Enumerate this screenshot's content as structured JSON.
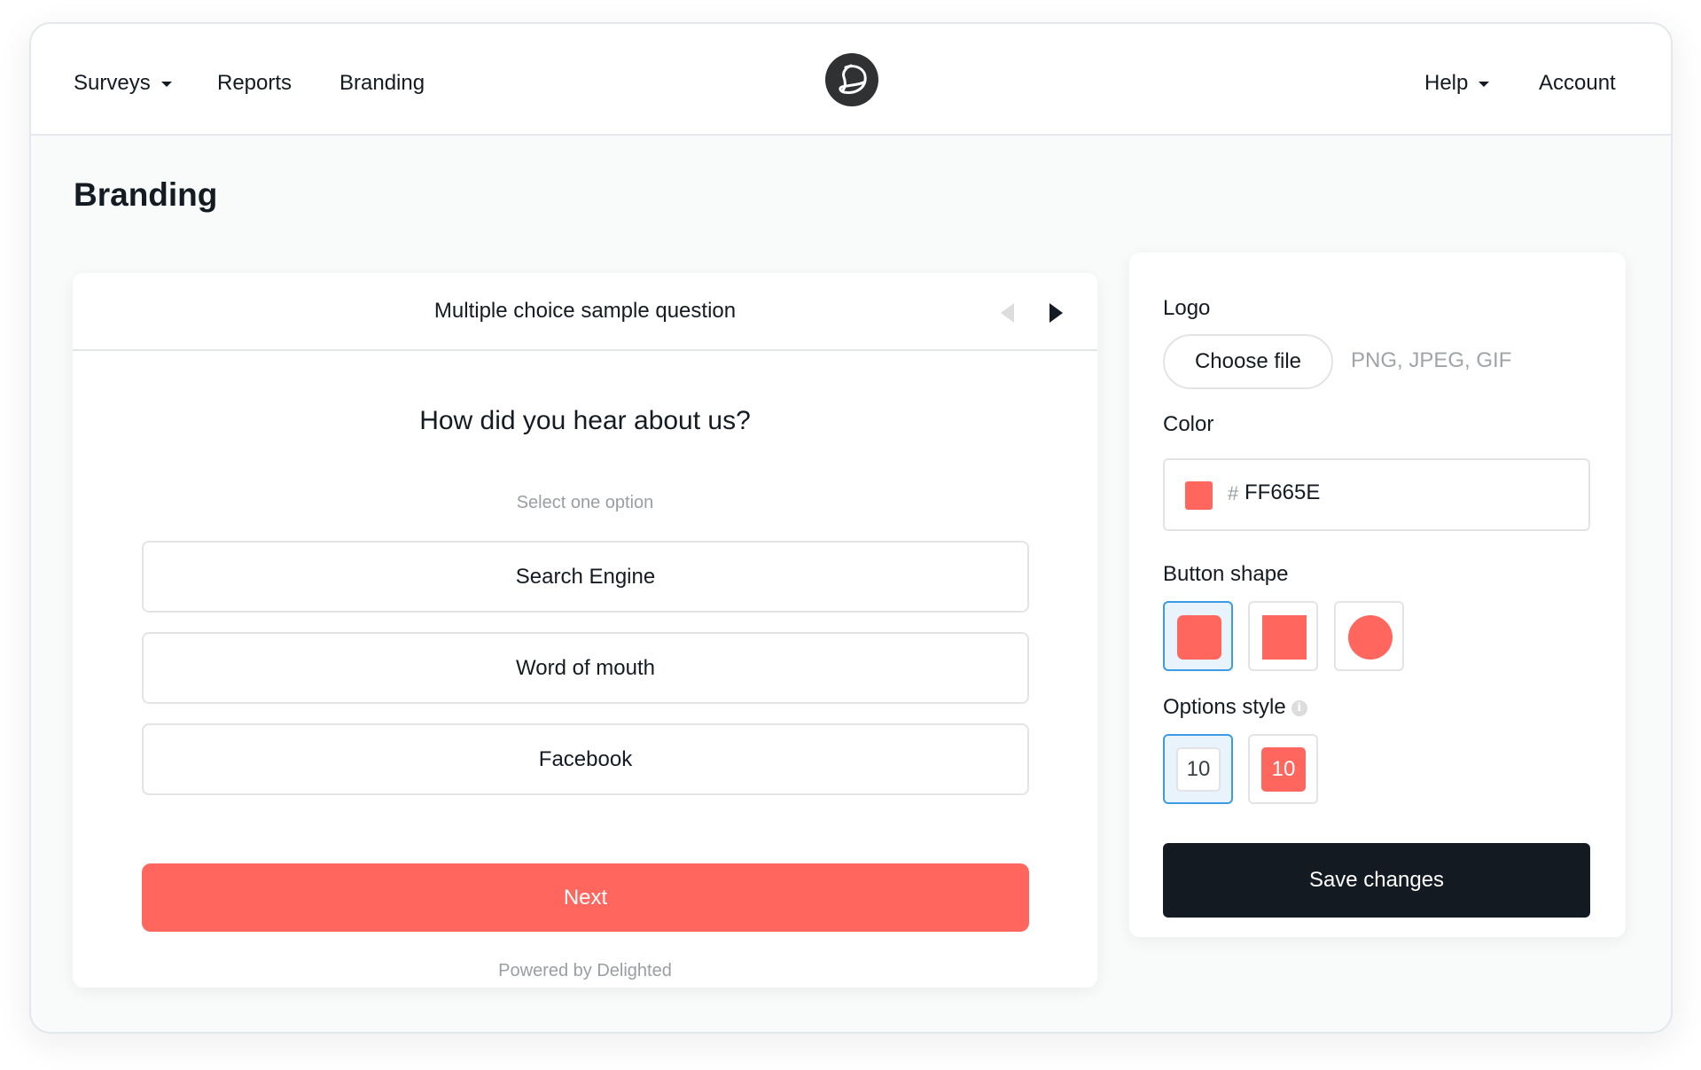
{
  "nav": {
    "left": [
      {
        "label": "Surveys",
        "has_dropdown": true
      },
      {
        "label": "Reports",
        "has_dropdown": false
      },
      {
        "label": "Branding",
        "has_dropdown": false
      }
    ],
    "right": [
      {
        "label": "Help",
        "has_dropdown": true
      },
      {
        "label": "Account",
        "has_dropdown": false
      }
    ],
    "logo_icon": "delighted-logo-icon"
  },
  "page": {
    "title": "Branding"
  },
  "preview": {
    "header_title": "Multiple choice sample question",
    "prev_icon": "triangle-left-icon",
    "next_icon": "triangle-right-icon",
    "question": "How did you hear about us?",
    "hint": "Select one option",
    "options": [
      "Search Engine",
      "Word of mouth",
      "Facebook"
    ],
    "next_label": "Next",
    "powered_by": "Powered by Delighted"
  },
  "settings": {
    "logo_label": "Logo",
    "choose_file_label": "Choose file",
    "file_types": "PNG, JPEG, GIF",
    "color_label": "Color",
    "color_hash": "#",
    "color_value": "FF665E",
    "button_shape_label": "Button shape",
    "button_shapes": [
      {
        "name": "rounded",
        "selected": true
      },
      {
        "name": "square",
        "selected": false
      },
      {
        "name": "circle",
        "selected": false
      }
    ],
    "options_style_label": "Options style",
    "options_style_info_icon": "info-icon",
    "options_styles": [
      {
        "name": "outline",
        "sample": "10",
        "selected": true
      },
      {
        "name": "filled",
        "sample": "10",
        "selected": false
      }
    ],
    "save_label": "Save changes"
  },
  "colors": {
    "brand": "#FF665E",
    "dark": "#131A21",
    "selected_border": "#3B9BE5",
    "selected_bg": "#E8F3FC"
  }
}
